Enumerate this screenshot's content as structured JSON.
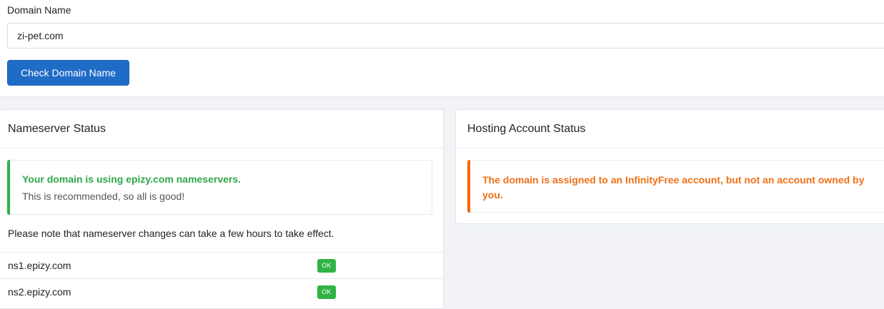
{
  "form": {
    "domain_label": "Domain Name",
    "domain_value": "zi-pet.com",
    "check_button": "Check Domain Name"
  },
  "nameserver_card": {
    "title": "Nameserver Status",
    "alert": {
      "title": "Your domain is using epizy.com nameservers.",
      "text": "This is recommended, so all is good!"
    },
    "note": "Please note that nameserver changes can take a few hours to take effect.",
    "rows": [
      {
        "name": "ns1.epizy.com",
        "status": "OK"
      },
      {
        "name": "ns2.epizy.com",
        "status": "OK"
      }
    ]
  },
  "hosting_card": {
    "title": "Hosting Account Status",
    "alert": {
      "title": "The domain is assigned to an InfinityFree account, but not an account owned by you."
    }
  },
  "colors": {
    "primary": "#1f6cc7",
    "success": "#2fb344",
    "warning": "#f76707",
    "page_background": "#f1f3f6"
  }
}
